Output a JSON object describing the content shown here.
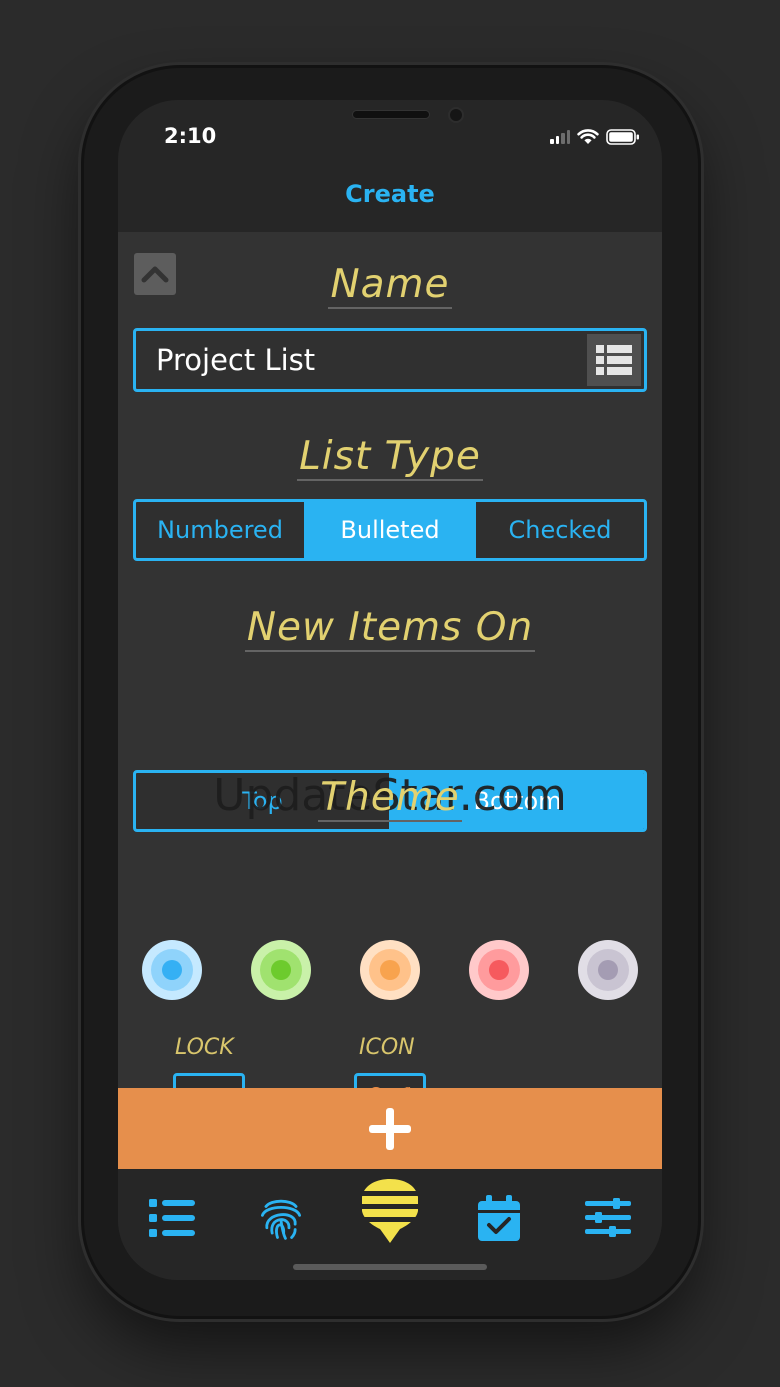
{
  "status_bar": {
    "time": "2:10"
  },
  "nav": {
    "title": "Create"
  },
  "name_section": {
    "label": "Name",
    "input_value": "Project List"
  },
  "list_type_section": {
    "label": "List Type",
    "options": [
      "Numbered",
      "Bulleted",
      "Checked"
    ],
    "selected": "Bulleted"
  },
  "new_items_section": {
    "label": "New Items On",
    "options": [
      "Top",
      "Bottom"
    ],
    "selected": "Bottom"
  },
  "theme_section": {
    "label": "Theme",
    "colors": [
      {
        "outer": "#c5e9ff",
        "ring": "#8fd3fb",
        "core": "#35b0f4"
      },
      {
        "outer": "#c9f1a9",
        "ring": "#a0e26f",
        "core": "#6dcb2d"
      },
      {
        "outer": "#ffe0c3",
        "ring": "#ffc28a",
        "core": "#f8a34e"
      },
      {
        "outer": "#ffc9ca",
        "ring": "#ff9b9d",
        "core": "#f65a5e"
      },
      {
        "outer": "#e1dee6",
        "ring": "#c9c4d2",
        "core": "#a49cb3"
      }
    ]
  },
  "options": {
    "lock_label": "LOCK",
    "lock_icon": "fingerprint-icon",
    "icon_label": "ICON",
    "icon_icon": "tools-icon"
  },
  "add_button": {
    "icon": "plus-icon"
  },
  "watermark": "UpdateStar.com",
  "tab_bar": {
    "items": [
      "list-icon",
      "fingerprint-icon",
      "beehive-icon",
      "calendar-check-icon",
      "sliders-icon"
    ]
  },
  "colors": {
    "accent": "#2ab3f2",
    "label_yellow": "#e2d170",
    "add_orange": "#e68f4c"
  }
}
